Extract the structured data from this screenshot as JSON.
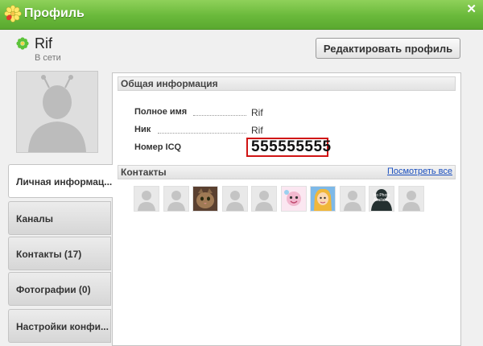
{
  "window": {
    "title": "Профиль"
  },
  "user": {
    "name": "Rif",
    "status": "В сети"
  },
  "actions": {
    "edit_profile": "Редактировать профиль"
  },
  "tabs": [
    {
      "label": "Личная информац...",
      "active": true
    },
    {
      "label": "Каналы"
    },
    {
      "label": "Контакты (17)"
    },
    {
      "label": "Фотографии (0)"
    },
    {
      "label": "Настройки конфи..."
    }
  ],
  "general": {
    "header": "Общая информация",
    "fields": [
      {
        "label": "Полное имя",
        "value": "Rif"
      },
      {
        "label": "Ник",
        "value": "Rif"
      },
      {
        "label": "Номер ICQ",
        "value": "555555555"
      }
    ]
  },
  "contacts": {
    "header": "Контакты",
    "see_all": "Посмотреть все",
    "items": [
      {
        "type": "silhouette"
      },
      {
        "type": "silhouette"
      },
      {
        "type": "cat-photo"
      },
      {
        "type": "silhouette"
      },
      {
        "type": "silhouette"
      },
      {
        "type": "cartoon-pink"
      },
      {
        "type": "cartoon-girl"
      },
      {
        "type": "silhouette"
      },
      {
        "type": "no-photo",
        "text": "No Photo Available"
      },
      {
        "type": "silhouette"
      }
    ]
  },
  "colors": {
    "titlebar": "#6ab93b",
    "link": "#1a4fbf",
    "highlight": "#d01414"
  }
}
